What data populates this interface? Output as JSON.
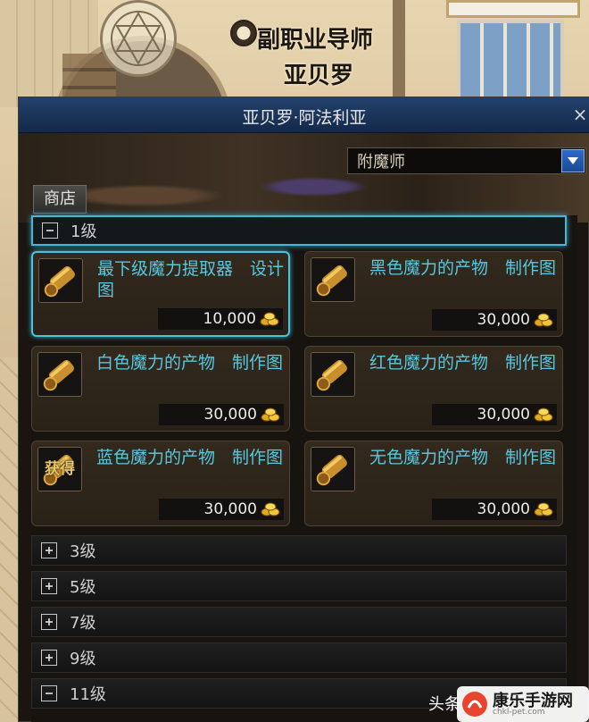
{
  "npc": {
    "title": "副职业导师",
    "name": "亚贝罗"
  },
  "window": {
    "title": "亚贝罗·阿法利亚",
    "close_glyph": "×"
  },
  "job_select": {
    "value": "附魔师"
  },
  "tabs": [
    {
      "label": "商店"
    }
  ],
  "groups": [
    {
      "label": "1级",
      "expanded": true,
      "items": [
        {
          "name": "最下级魔力提取器　设计图",
          "price": "10,000",
          "icon": "scroll-icon",
          "selected": true
        },
        {
          "name": "黑色魔力的产物　制作图",
          "price": "30,000",
          "icon": "scroll-icon"
        },
        {
          "name": "白色魔力的产物　制作图",
          "price": "30,000",
          "icon": "scroll-icon"
        },
        {
          "name": "红色魔力的产物　制作图",
          "price": "30,000",
          "icon": "scroll-icon"
        },
        {
          "name": "蓝色魔力的产物　制作图",
          "price": "30,000",
          "icon": "obtained-scroll-icon",
          "icon_label": "获得"
        },
        {
          "name": "无色魔力的产物　制作图",
          "price": "30,000",
          "icon": "scroll-icon"
        }
      ]
    },
    {
      "label": "3级",
      "expanded": false
    },
    {
      "label": "5级",
      "expanded": false
    },
    {
      "label": "7级",
      "expanded": false
    },
    {
      "label": "9级",
      "expanded": false
    },
    {
      "label": "11级",
      "expanded": true
    }
  ],
  "currency_icon": "gold-coins-icon",
  "watermark": {
    "prefix": "头条",
    "name": "康乐手游网",
    "url": "chkl-pet.com"
  },
  "colors": {
    "item_name": "#56c8e0",
    "title_bar": "#22416b",
    "select_border": "#4ac3df"
  }
}
